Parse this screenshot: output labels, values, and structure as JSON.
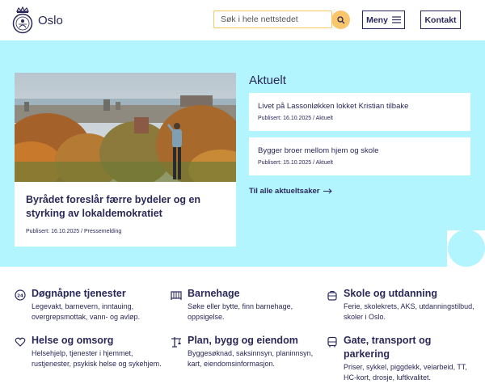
{
  "header": {
    "logo_text": "Oslo",
    "search_placeholder": "Søk i hele nettstedet",
    "menu_label": "Meny",
    "contact_label": "Kontakt"
  },
  "feature": {
    "title": "Byrådet foreslår færre bydeler og en styrking av lokaldemokratiet",
    "meta": "Publisert: 16.10.2025 / Pressemelding"
  },
  "news": {
    "heading": "Aktuelt",
    "items": [
      {
        "title": "Livet på Lassonløkken lokket Kristian tilbake",
        "meta": "Publisert: 16.10.2025 / Aktuelt"
      },
      {
        "title": "Bygger broer mellom hjem og skole",
        "meta": "Publisert: 15.10.2025 / Aktuelt"
      }
    ],
    "all_link": "Til alle aktueltsaker"
  },
  "services": [
    {
      "name": "Døgnåpne tjenester",
      "desc": "Legevakt, barnevern, inntauing, overgrepsmottak, vann- og avløp.",
      "icon": "24h-clock-icon"
    },
    {
      "name": "Barnehage",
      "desc": "Søke eller bytte, finn barnehage, oppsigelse.",
      "icon": "crib-icon"
    },
    {
      "name": "Skole og utdanning",
      "desc": "Ferie, skolekrets, AKS, utdanningstilbud, skoler i Oslo.",
      "icon": "school-bag-icon"
    },
    {
      "name": "Helse og omsorg",
      "desc": "Helsehjelp, tjenester i hjemmet, rustjenester, psykisk helse og sykehjem.",
      "icon": "heart-hand-icon"
    },
    {
      "name": "Plan, bygg og eiendom",
      "desc": "Byggesøknad, saksinnsyn, planinnsyn, kart, eiendomsinformasjon.",
      "icon": "crane-icon"
    },
    {
      "name": "Gate, transport og parkering",
      "desc": "Priser, sykkel, piggdekk, veiarbeid, TT, HC-kort, drosje, luftkvalitet.",
      "icon": "bus-icon"
    }
  ]
}
